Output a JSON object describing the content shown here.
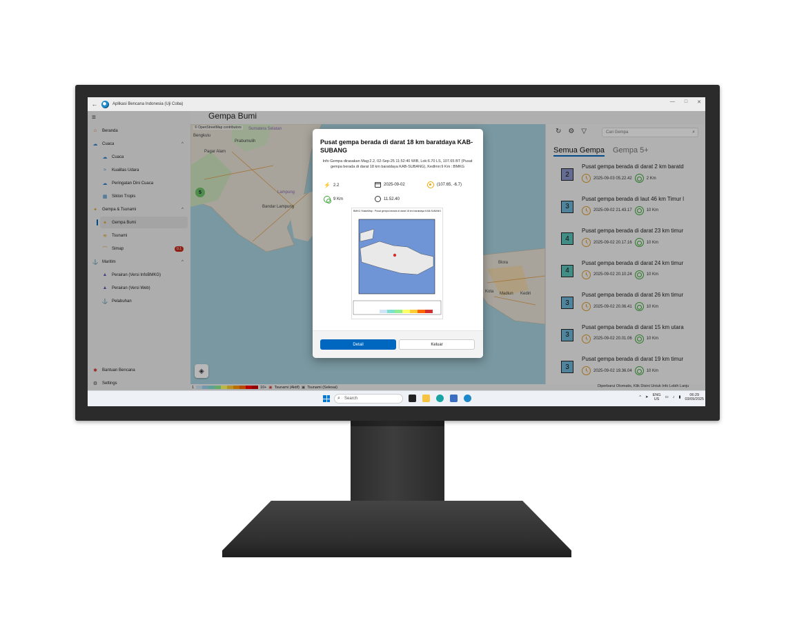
{
  "window": {
    "title": "Aplikasi Bencana Indonesia (Uji Coba)",
    "controls": [
      "—",
      "□",
      "✕"
    ]
  },
  "sidebar": {
    "items": [
      {
        "label": "Beranda"
      },
      {
        "label": "Cuaca"
      },
      {
        "label": "Cuaca"
      },
      {
        "label": "Kualitas Udara"
      },
      {
        "label": "Peringatan Dini Cuaca"
      },
      {
        "label": "Siklon Tropis"
      },
      {
        "label": "Gempa & Tsunami"
      },
      {
        "label": "Gempa Bumi"
      },
      {
        "label": "Tsunami"
      },
      {
        "label": "Simap",
        "badge": "0.1"
      },
      {
        "label": "Maritim"
      },
      {
        "label": "Perairan (Versi InfoBMKG)"
      },
      {
        "label": "Perairan (Versi Web)"
      },
      {
        "label": "Pelabuhan"
      }
    ],
    "footer": [
      {
        "label": "Bantuan Bencana"
      },
      {
        "label": "Settings"
      }
    ]
  },
  "page": {
    "title": "Gempa Bumi"
  },
  "map": {
    "attribution": "© OpenStreetMap contributors",
    "cluster_count": "5",
    "labels": [
      "Pagar Alam",
      "Prabumulih",
      "Sumatera Selatan",
      "Bengkulu",
      "Bandar Lampung",
      "Lampung",
      "Kota",
      "Madiun",
      "Kediri",
      "Blora"
    ]
  },
  "legend": {
    "text_start": "1",
    "text_end": "10+",
    "tsunami_active": "Tsunami (Aktif)",
    "tsunami_done": "Tsunami (Selesai)",
    "scale_colors": [
      "#cfe5f7",
      "#9fd3f2",
      "#7fe0d0",
      "#90ee90",
      "#ffff66",
      "#ffcc33",
      "#ff9900",
      "#ff6600",
      "#ff0000",
      "#cc0000"
    ]
  },
  "right_panel": {
    "search_placeholder": "Cari Gempa",
    "tabs": [
      "Semua Gempa",
      "Gempa 5+"
    ],
    "earthquakes": [
      {
        "mag": "2",
        "title": "Pusat gempa berada di darat 2 km baratd",
        "datetime": "2025-09-03 05.22.42",
        "depth": "2 Km",
        "color": "#8d96c9"
      },
      {
        "mag": "3",
        "title": "Pusat gempa berada di laut 46 km Timur l",
        "datetime": "2025-09-02 21.43.17",
        "depth": "10 Km",
        "color": "#6fb8d8"
      },
      {
        "mag": "4",
        "title": "Pusat gempa berada di darat 23 km timur",
        "datetime": "2025-09-02 20.17.16",
        "depth": "10 Km",
        "color": "#5cc4b9"
      },
      {
        "mag": "4",
        "title": "Pusat gempa berada di darat 24 km timur",
        "datetime": "2025-09-02 20.10.24",
        "depth": "10 Km",
        "color": "#5cc4b9"
      },
      {
        "mag": "3",
        "title": "Pusat gempa berada di darat 26 km timur",
        "datetime": "2025-09-02 20.06.41",
        "depth": "10 Km",
        "color": "#6fb8d8"
      },
      {
        "mag": "3",
        "title": "Pusat gempa berada di darat 15 km utara",
        "datetime": "2025-09-02 20.01.06",
        "depth": "10 Km",
        "color": "#6fb8d8"
      },
      {
        "mag": "3",
        "title": "Pusat gempa berada di darat 19 km timur",
        "datetime": "2025-09-02 19.36.04",
        "depth": "10 Km",
        "color": "#6fb8d8"
      }
    ],
    "footer": "Diperbarui Otomatis, Klik Disini Untuk Info Lebih Lanju"
  },
  "dialog": {
    "title": "Pusat gempa berada di darat 18 km baratdaya KAB-SUBANG",
    "info": "Info Gempa dirasakan Mag:2.2, 02-Sep-25 11:52:40 WIB, Lok:6.70 LS, 107.65 BT (Pusat gempa berada di darat 18 km baratdaya KAB-SUBANG), Kedlmn:9 Km ::BMKG",
    "magnitude": "2.2",
    "date": "2025-09-02",
    "coordinates": "(107.65, -6.7)",
    "depth": "9 Km",
    "time": "11.52.40",
    "shakemap_caption": "BMKG ShakeMap : Pusat gempa berada di darat 18 km baratdaya KAB-SUBANG",
    "detail_label": "Detail",
    "close_label": "Keluar"
  },
  "taskbar": {
    "search_placeholder": "Search",
    "lang_top": "ENG",
    "lang_bottom": "US",
    "time": "06:29",
    "date": "03/09/2025"
  }
}
